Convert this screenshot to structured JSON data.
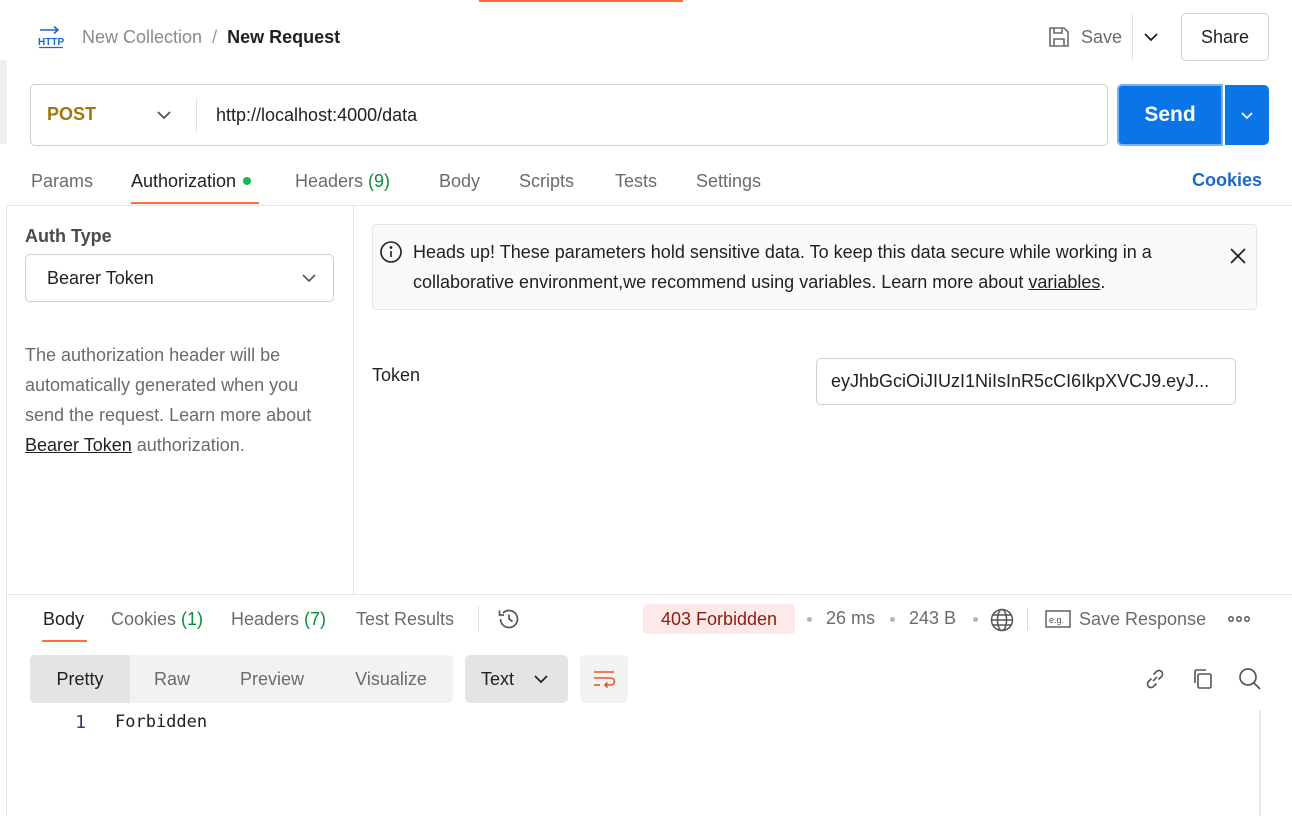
{
  "header": {
    "collection": "New Collection",
    "separator": "/",
    "request_name": "New Request",
    "save_label": "Save",
    "share_label": "Share"
  },
  "request": {
    "method": "POST",
    "url": "http://localhost:4000/data",
    "send_label": "Send",
    "method_color": "#a0770c",
    "send_color": "#0a75e6"
  },
  "tabs": {
    "params": "Params",
    "authorization": "Authorization",
    "headers": "Headers",
    "headers_count": "(9)",
    "body": "Body",
    "scripts": "Scripts",
    "tests": "Tests",
    "settings": "Settings",
    "cookies": "Cookies",
    "active": "Authorization"
  },
  "auth": {
    "type_label": "Auth Type",
    "type_value": "Bearer Token",
    "desc_prefix": "The authorization header will be automatically generated when you send the request. Learn more about ",
    "desc_link": "Bearer Token",
    "desc_suffix": " authorization."
  },
  "alert": {
    "text": "Heads up! These parameters hold sensitive data. To keep this data secure while working in a collaborative environment,we recommend using variables. Learn more about ",
    "link": "variables",
    "end": "."
  },
  "token": {
    "label": "Token",
    "value": "eyJhbGciOiJIUzI1NiIsInR5cCI6IkpXVCJ9.eyJ..."
  },
  "response": {
    "tabs": {
      "body": "Body",
      "cookies": "Cookies",
      "cookies_count": "(1)",
      "headers": "Headers",
      "headers_count": "(7)",
      "test_results": "Test Results"
    },
    "status": "403 Forbidden",
    "time": "26 ms",
    "size": "243 B",
    "save_label": "Save Response",
    "views": [
      "Pretty",
      "Raw",
      "Preview",
      "Visualize"
    ],
    "active_view": "Pretty",
    "format": "Text",
    "lines": [
      {
        "num": "1",
        "text": "Forbidden"
      }
    ]
  },
  "icons": {
    "http": "http-icon",
    "save": "floppy-disk-icon",
    "info": "info-circle-icon",
    "close": "close-icon",
    "history": "history-icon",
    "globe": "globe-icon",
    "example": "example-icon",
    "more": "more-horizontal-icon",
    "wrap": "wrap-lines-icon",
    "link": "link-icon",
    "copy": "copy-icon",
    "search": "search-icon"
  }
}
